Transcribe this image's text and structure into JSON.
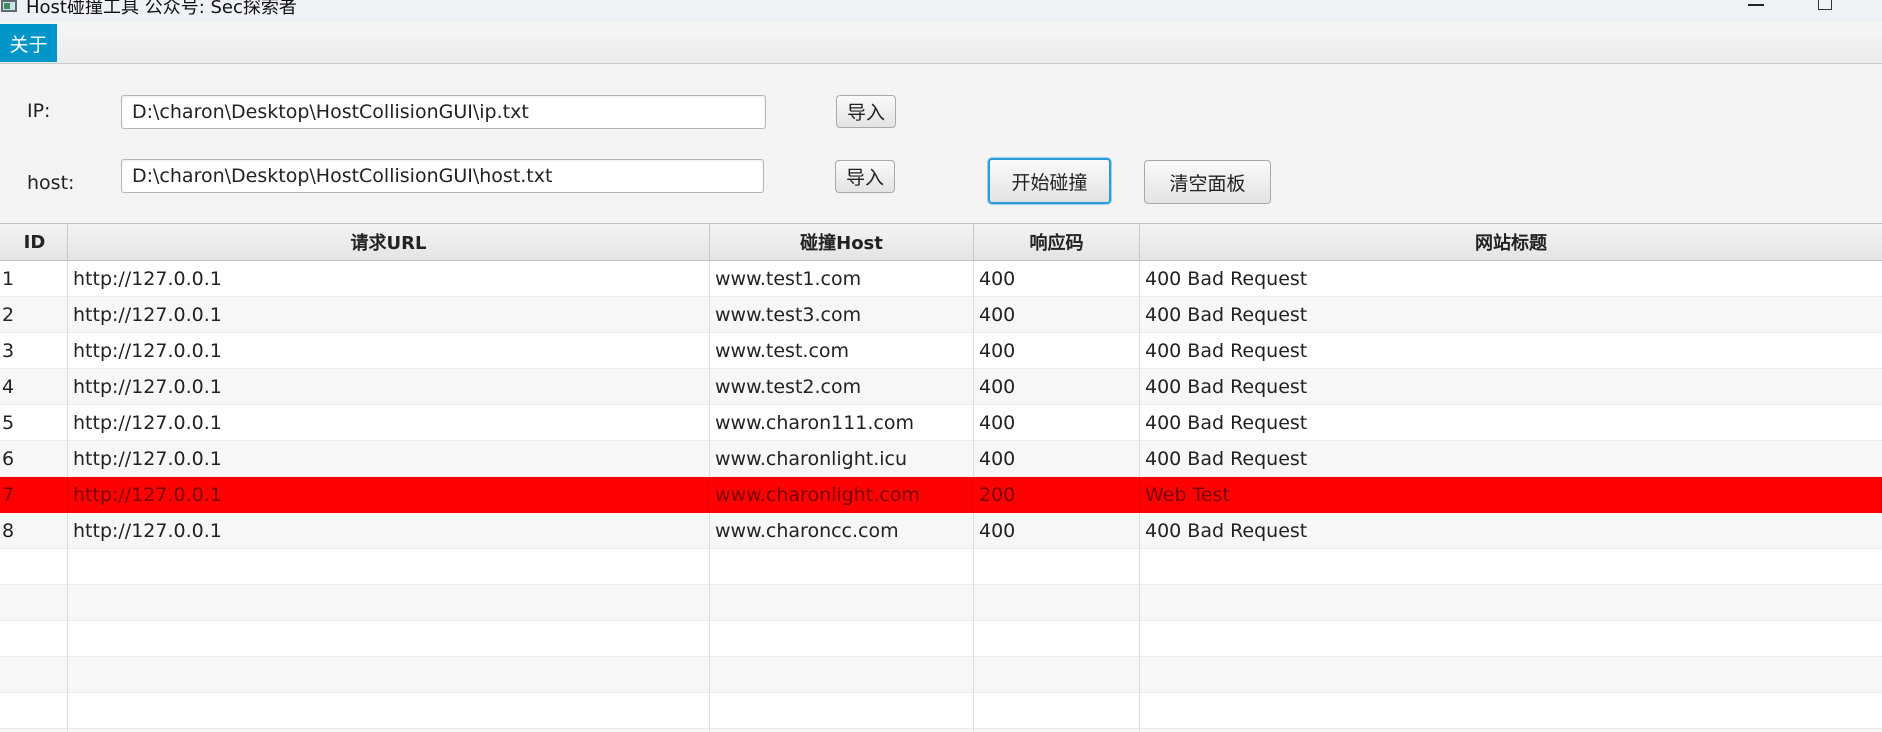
{
  "window": {
    "title": "Host碰撞工具 公众号: Sec探索者"
  },
  "menu": {
    "items": [
      "关于"
    ]
  },
  "form": {
    "ip_label": "IP:",
    "ip_value": "D:\\charon\\Desktop\\HostCollisionGUI\\ip.txt",
    "host_label": "host:",
    "host_value": "D:\\charon\\Desktop\\HostCollisionGUI\\host.txt",
    "import_label": "导入",
    "start_label": "开始碰撞",
    "clear_label": "清空面板"
  },
  "table": {
    "columns": [
      "ID",
      "请求URL",
      "碰撞Host",
      "响应码",
      "网站标题"
    ],
    "rows": [
      [
        "1",
        "http://127.0.0.1",
        "www.test1.com",
        "400",
        "400 Bad Request"
      ],
      [
        "2",
        "http://127.0.0.1",
        "www.test3.com",
        "400",
        "400 Bad Request"
      ],
      [
        "3",
        "http://127.0.0.1",
        "www.test.com",
        "400",
        "400 Bad Request"
      ],
      [
        "4",
        "http://127.0.0.1",
        "www.test2.com",
        "400",
        "400 Bad Request"
      ],
      [
        "5",
        "http://127.0.0.1",
        "www.charon111.com",
        "400",
        "400 Bad Request"
      ],
      [
        "6",
        "http://127.0.0.1",
        "www.charonlight.icu",
        "400",
        "400 Bad Request"
      ],
      [
        "7",
        "http://127.0.0.1",
        "www.charonlight.com",
        "200",
        "Web Test"
      ],
      [
        "8",
        "http://127.0.0.1",
        "www.charoncc.com",
        "400",
        "400 Bad Request"
      ]
    ],
    "highlight_row_id": "7",
    "highlight_color": "#ff0000",
    "empty_rows": 6
  },
  "colors": {
    "accent": "#0096c9",
    "focus": "#2b9ad6"
  }
}
